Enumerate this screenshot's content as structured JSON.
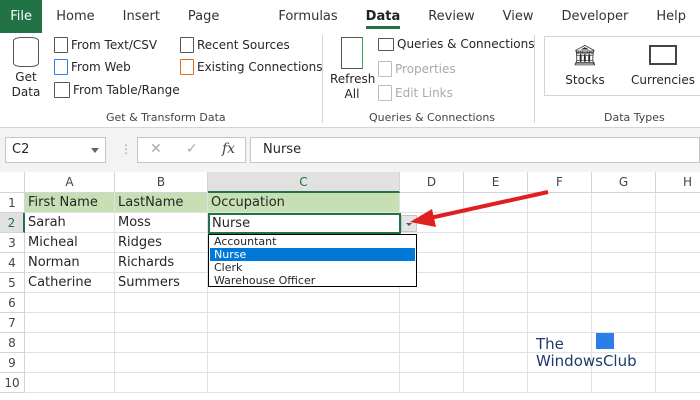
{
  "tabs": [
    "File",
    "Home",
    "Insert",
    "Page Layout",
    "Formulas",
    "Data",
    "Review",
    "View",
    "Developer",
    "Help"
  ],
  "active_tab": "Data",
  "ribbon": {
    "get_transform": {
      "get_data": "Get",
      "get_data2": "Data",
      "from_text": "From Text/CSV",
      "from_web": "From Web",
      "from_table": "From Table/Range",
      "recent": "Recent Sources",
      "existing": "Existing Connections",
      "label": "Get & Transform Data"
    },
    "queries": {
      "refresh": "Refresh",
      "refresh2": "All",
      "queries": "Queries & Connections",
      "properties": "Properties",
      "edit_links": "Edit Links",
      "label": "Queries & Connections"
    },
    "data_types": {
      "stocks": "Stocks",
      "currencies": "Currencies",
      "label": "Data Types"
    }
  },
  "formula_bar": {
    "name_box": "C2",
    "cancel": "✕",
    "enter": "✓",
    "fx": "fx",
    "value": "Nurse"
  },
  "columns": [
    "A",
    "B",
    "C",
    "D",
    "E",
    "F",
    "G",
    "H"
  ],
  "rows": [
    "1",
    "2",
    "3",
    "4",
    "5",
    "6",
    "7",
    "8",
    "9",
    "10"
  ],
  "cells": [
    [
      "First Name",
      "LastName",
      "Occupation"
    ],
    [
      "Sarah",
      "Moss",
      "Nurse"
    ],
    [
      "Micheal",
      "Ridges",
      ""
    ],
    [
      "Norman",
      "Richards",
      ""
    ],
    [
      "Catherine",
      "Summers",
      ""
    ]
  ],
  "dropdown": {
    "options": [
      "Accountant",
      "Nurse",
      "Clerk",
      "Warehouse Officer"
    ],
    "selected": "Nurse"
  },
  "watermark": {
    "line1": "The",
    "line2": "WindowsClub"
  },
  "colors": {
    "excel_green": "#217346",
    "header_fill": "#c6e0b4",
    "selection": "#0078d7",
    "arrow": "#e02020"
  }
}
